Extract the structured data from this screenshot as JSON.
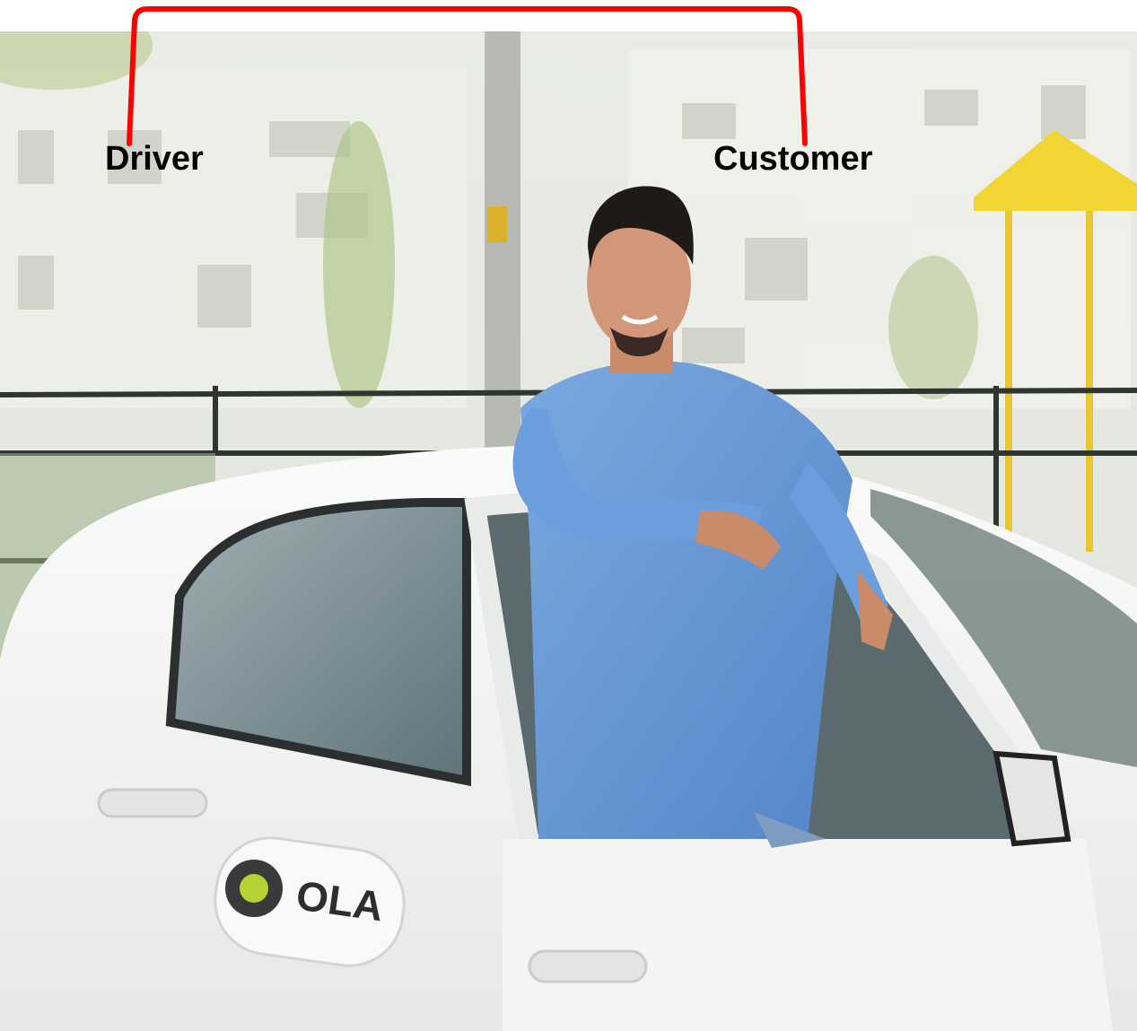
{
  "labels": {
    "driver": "Driver",
    "customer": "Customer"
  },
  "photo": {
    "subject": "smiling man in blue shirt leaning on open door of white taxi car",
    "logo_text": "OLA",
    "logo_ring_color": "#3a3a3a",
    "logo_dot_color": "#b5d334"
  },
  "colors": {
    "connector": "#ff0000",
    "label_text": "#000000",
    "shirt": "#6e9fd9",
    "car_body": "#f4f5f4"
  }
}
